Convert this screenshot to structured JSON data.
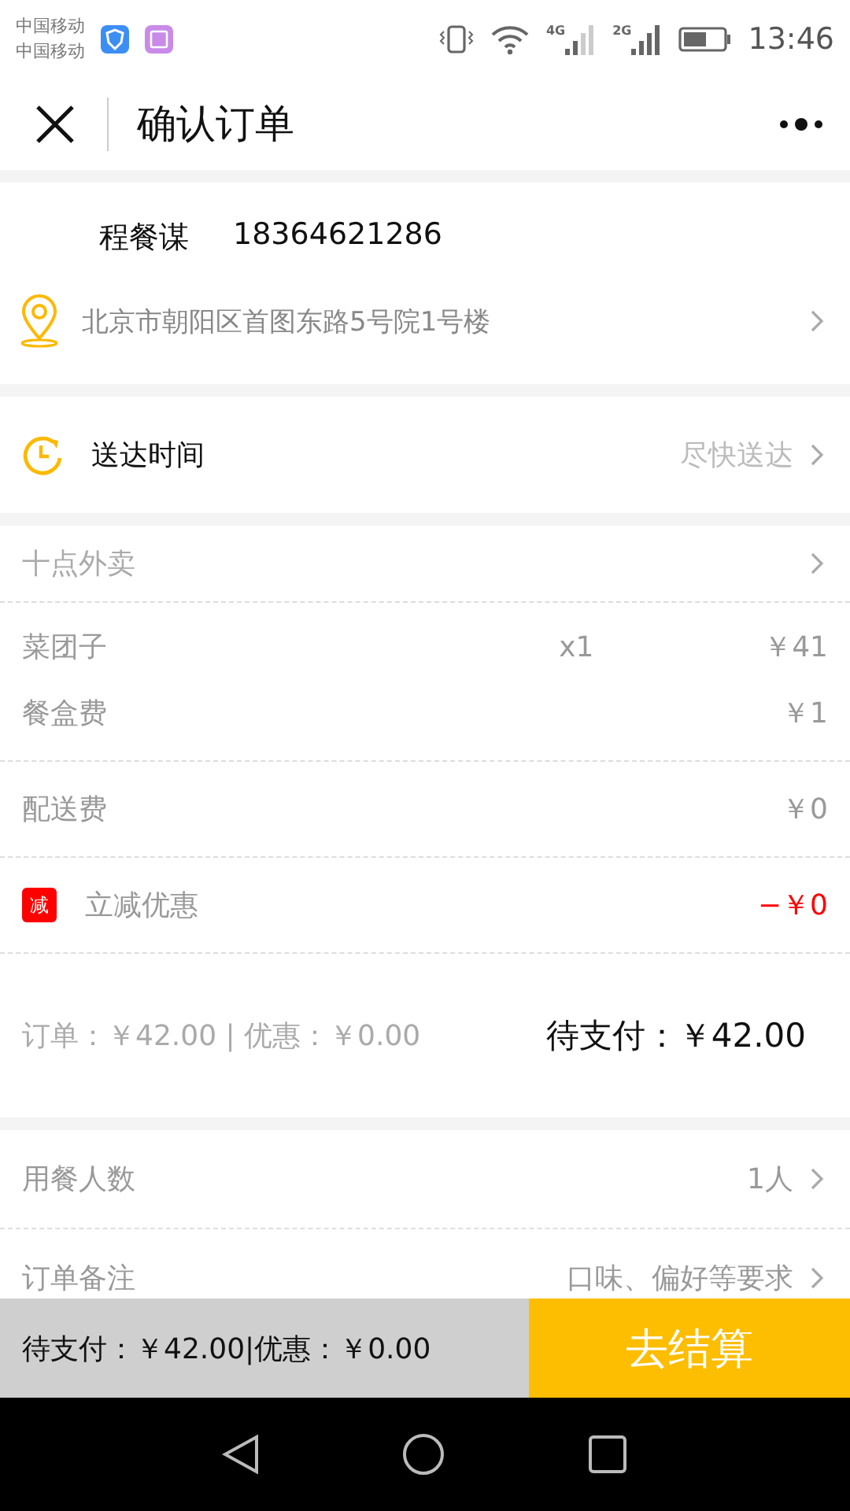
{
  "status_bar": {
    "carriers": [
      "中国移动",
      "中国移动"
    ],
    "networks": [
      "4G",
      "2G"
    ],
    "time": "13:46"
  },
  "header": {
    "title": "确认订单"
  },
  "contact": {
    "name": "程餐谋",
    "phone": "18364621286",
    "address": "北京市朝阳区首图东路5号院1号楼"
  },
  "delivery": {
    "label": "送达时间",
    "value": "尽快送达"
  },
  "store": {
    "name": "十点外卖"
  },
  "order_groups": [
    [
      {
        "kind": "item",
        "name": "菜团子",
        "qty": "x1",
        "price": "￥41"
      },
      {
        "kind": "fee",
        "name": "餐盒费",
        "price": "￥1"
      }
    ],
    [
      {
        "kind": "fee",
        "name": "配送费",
        "price": "￥0"
      }
    ],
    [
      {
        "kind": "discount",
        "badge": "减",
        "name": "立减优惠",
        "price": "−￥0"
      }
    ]
  ],
  "summary": {
    "order": "订单：￥42.00 | 优惠：￥0.00",
    "due": "待支付：￥42.00"
  },
  "extras": [
    {
      "label": "用餐人数",
      "value": "1人"
    },
    {
      "label": "订单备注",
      "value": "口味、偏好等要求"
    }
  ],
  "checkout": {
    "summary": "待支付：￥42.00|优惠：￥0.00",
    "button": "去结算"
  }
}
